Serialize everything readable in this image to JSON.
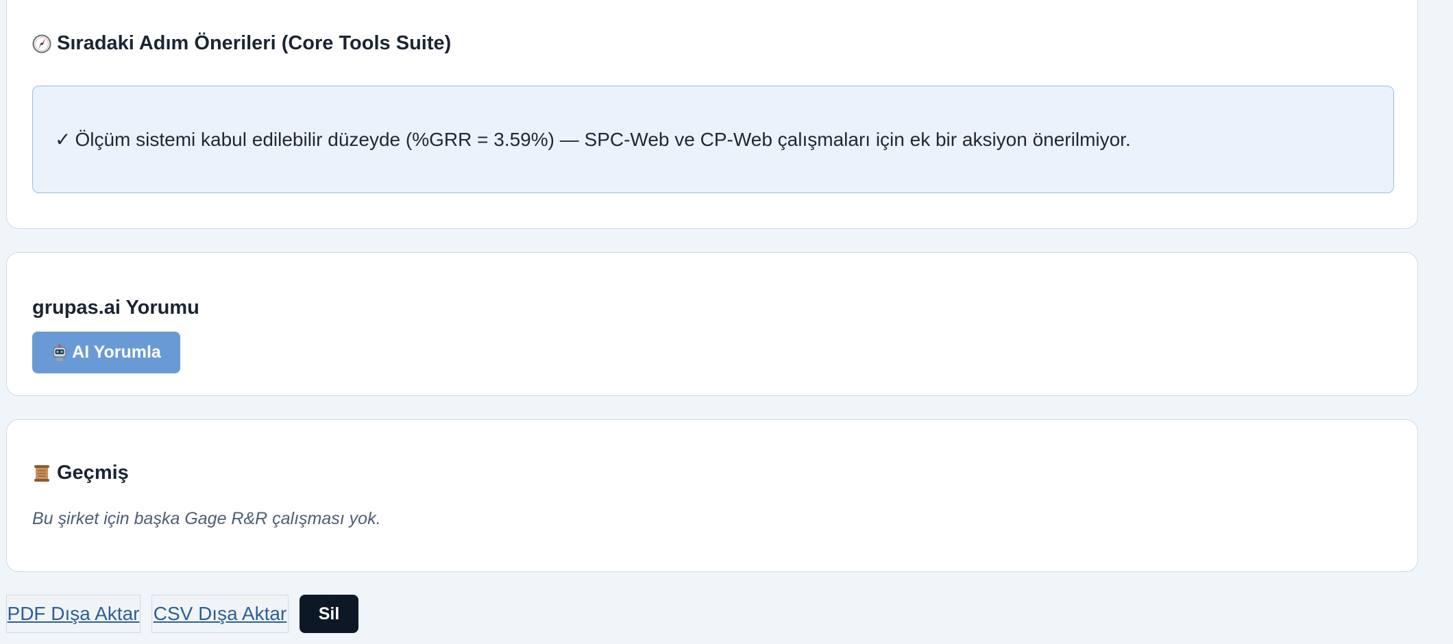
{
  "next_steps": {
    "icon": "compass-icon",
    "title": "Sıradaki Adım Önerileri (Core Tools Suite)",
    "check_symbol": "✓",
    "message": "Ölçüm sistemi kabul edilebilir düzeyde (%GRR = 3.59%) — SPC-Web ve CP-Web çalışmaları için ek bir aksiyon önerilmiyor."
  },
  "ai_section": {
    "title": "grupas.ai Yorumu",
    "button_icon": "robot-icon",
    "button_label": "AI Yorumla",
    "button_color": "#6a9ad6"
  },
  "history": {
    "icon": "scroll-icon",
    "title": "Geçmiş",
    "empty_message": "Bu şirket için başka Gage R&R çalışması yok."
  },
  "actions": {
    "pdf_label": "PDF Dışa Aktar",
    "csv_label": "CSV Dışa Aktar",
    "delete_label": "Sil",
    "delete_color": "#0d1826",
    "link_color": "#2b5f96"
  }
}
